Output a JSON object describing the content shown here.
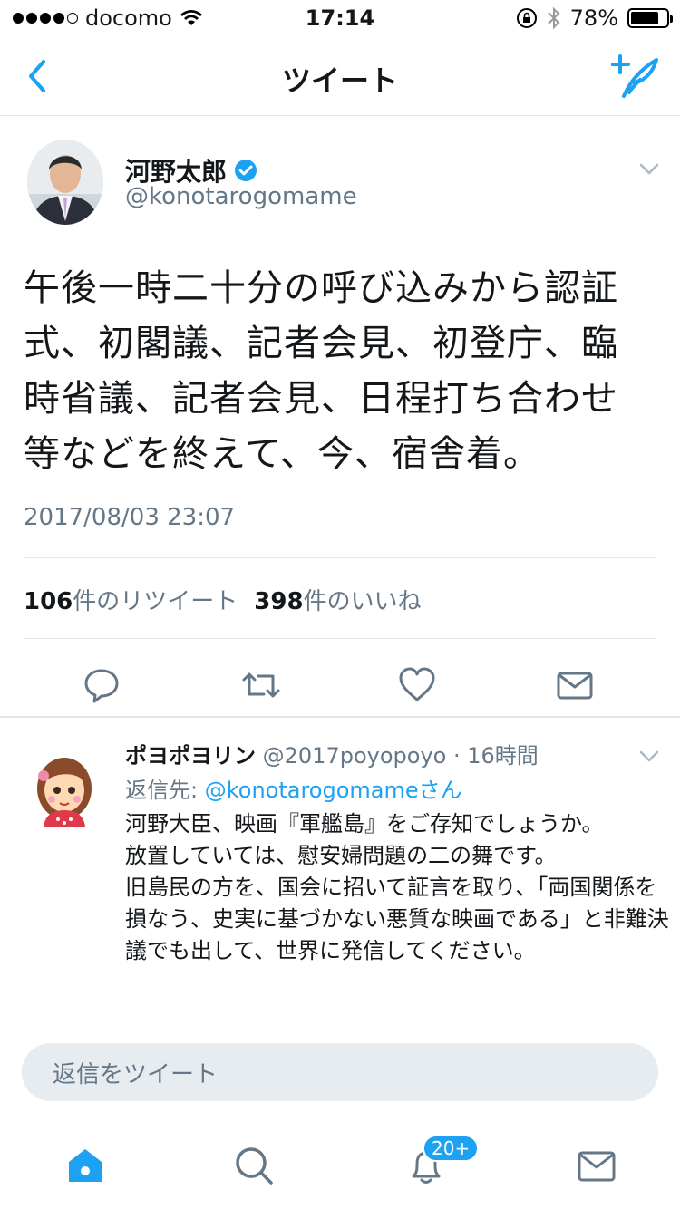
{
  "status_bar": {
    "carrier": "docomo",
    "time": "17:14",
    "battery": "78%",
    "battery_level": 0.78
  },
  "nav": {
    "title": "ツイート"
  },
  "tweet": {
    "author_name": "河野太郎",
    "author_handle": "@konotarogomame",
    "verified": true,
    "text": "午後一時二十分の呼び込みから認証式、初閣議、記者会見、初登庁、臨時省議、記者会見、日程打ち合わせ等などを終えて、今、宿舎着。",
    "timestamp": "2017/08/03 23:07",
    "retweet_count": "106",
    "retweet_label": "件のリツイート",
    "like_count": "398",
    "like_label": "件のいいね"
  },
  "reply": {
    "name": "ポヨポヨリン",
    "handle": "@2017poyopoyo",
    "time": "· 16時間",
    "reply_to_label": "返信先: ",
    "reply_to_handle": "@konotarogomameさん",
    "text": "河野大臣、映画『軍艦島』をご存知でしょうか。\n放置していては、慰安婦問題の二の舞です。\n旧島民の方を、国会に招いて証言を取り、「両国関係を損なう、史実に基づかない悪質な映画である」と非難決議でも出して、世界に発信してください。"
  },
  "compose": {
    "placeholder": "返信をツイート"
  },
  "tabbar": {
    "notification_badge": "20+"
  },
  "colors": {
    "accent": "#1da1f2",
    "muted": "#657786",
    "divider": "#e1e8ed"
  }
}
